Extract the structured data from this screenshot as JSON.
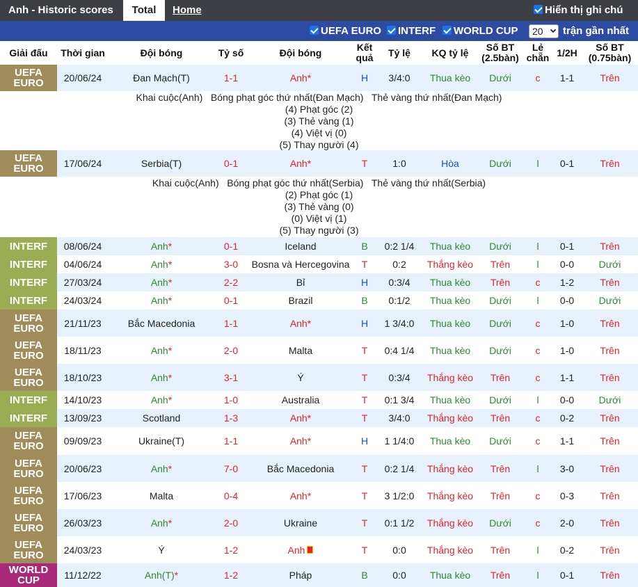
{
  "tabs": {
    "title": "Anh - Historic scores",
    "total": "Total",
    "home": "Home"
  },
  "show_notes": "Hiển thị ghi chú",
  "filters": {
    "euro": "UEFA EURO",
    "interf": "INTERF",
    "worldcup": "WORLD CUP",
    "count": "20",
    "recent": "trận gần nhất"
  },
  "headers": {
    "league": "Giải đấu",
    "time": "Thời gian",
    "home": "Đội bóng",
    "score": "Tỷ số",
    "away": "Đội bóng",
    "result": "Kết quả",
    "odds": "Tỷ lệ",
    "odds_result": "KQ tỷ lệ",
    "ou25": "Số BT (2.5bàn)",
    "oddeven": "Lẻ chẵn",
    "half": "1/2H",
    "ou075": "Số BT (0.75bàn)"
  },
  "rows": [
    {
      "league": "UEFA EURO",
      "date": "20/06/24",
      "home": "Đan Mạch(T)",
      "score": "1-1",
      "away": "Anh",
      "result": "H",
      "odds": "3/4:0",
      "kq": "Thua kèo",
      "ou": "Dưới",
      "oe": "c",
      "half": "1-1",
      "ou2": "Trên"
    },
    {
      "league": "UEFA EURO",
      "date": "17/06/24",
      "home": "Serbia(T)",
      "score": "0-1",
      "away": "Anh",
      "result": "T",
      "odds": "1:0",
      "kq": "Hòa",
      "ou": "Dưới",
      "oe": "l",
      "half": "0-1",
      "ou2": "Trên"
    },
    {
      "league": "INTERF",
      "date": "08/06/24",
      "home": "Anh",
      "score": "0-1",
      "away": "Iceland",
      "result": "B",
      "odds": "0:2 1/4",
      "kq": "Thua kèo",
      "ou": "Dưới",
      "oe": "l",
      "half": "0-1",
      "ou2": "Trên"
    },
    {
      "league": "INTERF",
      "date": "04/06/24",
      "home": "Anh",
      "score": "3-0",
      "away": "Bosna và Hercegovina",
      "result": "T",
      "odds": "0:2",
      "kq": "Thắng kèo",
      "ou": "Trên",
      "oe": "l",
      "half": "0-0",
      "ou2": "Dưới"
    },
    {
      "league": "INTERF",
      "date": "27/03/24",
      "home": "Anh",
      "score": "2-2",
      "away": "Bỉ",
      "result": "H",
      "odds": "0:3/4",
      "kq": "Thua kèo",
      "ou": "Trên",
      "oe": "c",
      "half": "1-2",
      "ou2": "Trên"
    },
    {
      "league": "INTERF",
      "date": "24/03/24",
      "home": "Anh",
      "score": "0-1",
      "away": "Brazil",
      "result": "B",
      "odds": "0:1/2",
      "kq": "Thua kèo",
      "ou": "Dưới",
      "oe": "l",
      "half": "0-0",
      "ou2": "Dưới"
    },
    {
      "league": "UEFA EURO",
      "date": "21/11/23",
      "home": "Bắc Macedonia",
      "score": "1-1",
      "away": "Anh",
      "result": "H",
      "odds": "1 3/4:0",
      "kq": "Thua kèo",
      "ou": "Dưới",
      "oe": "c",
      "half": "1-0",
      "ou2": "Trên"
    },
    {
      "league": "UEFA EURO",
      "date": "18/11/23",
      "home": "Anh",
      "score": "2-0",
      "away": "Malta",
      "result": "T",
      "odds": "0:4 1/4",
      "kq": "Thua kèo",
      "ou": "Dưới",
      "oe": "c",
      "half": "1-0",
      "ou2": "Trên"
    },
    {
      "league": "UEFA EURO",
      "date": "18/10/23",
      "home": "Anh",
      "score": "3-1",
      "away": "Ý",
      "result": "T",
      "odds": "0:3/4",
      "kq": "Thắng kèo",
      "ou": "Trên",
      "oe": "c",
      "half": "1-1",
      "ou2": "Trên"
    },
    {
      "league": "INTERF",
      "date": "14/10/23",
      "home": "Anh",
      "score": "1-0",
      "away": "Australia",
      "result": "T",
      "odds": "0:1 3/4",
      "kq": "Thua kèo",
      "ou": "Dưới",
      "oe": "l",
      "half": "0-0",
      "ou2": "Dưới"
    },
    {
      "league": "INTERF",
      "date": "13/09/23",
      "home": "Scotland",
      "score": "1-3",
      "away": "Anh",
      "result": "T",
      "odds": "3/4:0",
      "kq": "Thắng kèo",
      "ou": "Trên",
      "oe": "c",
      "half": "0-2",
      "ou2": "Trên"
    },
    {
      "league": "UEFA EURO",
      "date": "09/09/23",
      "home": "Ukraine(T)",
      "score": "1-1",
      "away": "Anh",
      "result": "H",
      "odds": "1 1/4:0",
      "kq": "Thua kèo",
      "ou": "Dưới",
      "oe": "c",
      "half": "1-1",
      "ou2": "Trên"
    },
    {
      "league": "UEFA EURO",
      "date": "20/06/23",
      "home": "Anh",
      "score": "7-0",
      "away": "Bắc Macedonia",
      "result": "T",
      "odds": "0:2 1/4",
      "kq": "Thắng kèo",
      "ou": "Trên",
      "oe": "l",
      "half": "3-0",
      "ou2": "Trên"
    },
    {
      "league": "UEFA EURO",
      "date": "17/06/23",
      "home": "Malta",
      "score": "0-4",
      "away": "Anh",
      "result": "T",
      "odds": "3 1/2:0",
      "kq": "Thắng kèo",
      "ou": "Trên",
      "oe": "c",
      "half": "0-3",
      "ou2": "Trên"
    },
    {
      "league": "UEFA EURO",
      "date": "26/03/23",
      "home": "Anh",
      "score": "2-0",
      "away": "Ukraine",
      "result": "T",
      "odds": "0:1 1/2",
      "kq": "Thắng kèo",
      "ou": "Dưới",
      "oe": "c",
      "half": "2-0",
      "ou2": "Trên"
    },
    {
      "league": "UEFA EURO",
      "date": "24/03/23",
      "home": "Ý",
      "score": "1-2",
      "away": "Anh",
      "result": "T",
      "odds": "0:0",
      "kq": "Thắng kèo",
      "ou": "Trên",
      "oe": "l",
      "half": "0-2",
      "ou2": "Trên"
    },
    {
      "league": "WORLD CUP",
      "date": "11/12/22",
      "home": "Anh(T)",
      "score": "1-2",
      "away": "Pháp",
      "result": "B",
      "odds": "0:0",
      "kq": "Thua kèo",
      "ou": "Trên",
      "oe": "l",
      "half": "0-1",
      "ou2": "Trên"
    }
  ],
  "notes": [
    {
      "header": "Khai cuộc(Anh)   Bóng phạt góc thứ nhất(Đan Mạch)   Thẻ vàng thứ nhất(Đan Mạch)",
      "lines": [
        "(4) Phạt góc (2)",
        "(3) Thẻ vàng (1)",
        "(4) Việt vị (0)",
        "(5) Thay người (4)"
      ]
    },
    {
      "header": "Khai cuộc(Anh)   Bóng phạt góc thứ nhất(Serbia)   Thẻ vàng thứ nhất(Serbia)",
      "lines": [
        "(2) Phạt góc (1)",
        "(3) Thẻ vàng (0)",
        "(0) Việt vị (1)",
        "(5) Thay người (3)"
      ]
    }
  ]
}
